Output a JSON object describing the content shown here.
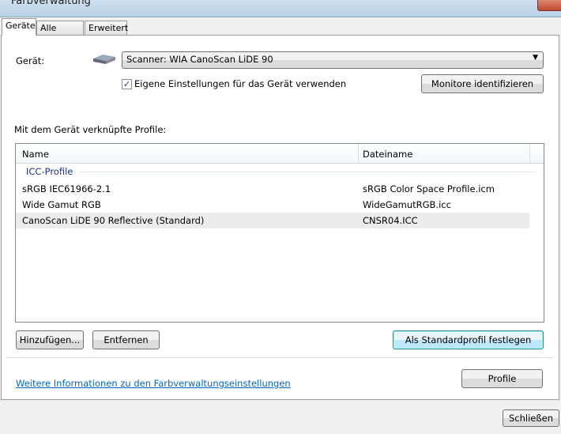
{
  "window": {
    "title": "Farbverwaltung"
  },
  "tabs": [
    {
      "label": "Geräte"
    },
    {
      "label": "Alle Profile"
    },
    {
      "label": "Erweitert"
    }
  ],
  "device": {
    "label": "Gerät:",
    "selected": "Scanner: WIA CanoScan LiDE 90",
    "use_own_settings_label": "Eigene Einstellungen für das Gerät verwenden",
    "use_own_settings_checked": true,
    "identify_button": "Monitore identifizieren"
  },
  "profiles": {
    "label": "Mit dem Gerät verknüpfte Profile:",
    "columns": [
      "Name",
      "Dateiname"
    ],
    "group": "ICC-Profile",
    "rows": [
      {
        "name": "sRGB IEC61966-2.1",
        "file": "sRGB Color Space Profile.icm"
      },
      {
        "name": "Wide Gamut RGB",
        "file": "WideGamutRGB.icc"
      },
      {
        "name": "CanoScan LiDE 90 Reflective (Standard)",
        "file": "CNSR04.ICC",
        "selected": true
      }
    ]
  },
  "buttons": {
    "add": "Hinzufügen...",
    "remove": "Entfernen",
    "set_default": "Als Standardprofil festlegen",
    "profile": "Profile",
    "close": "Schließen"
  },
  "link": "Weitere Informationen zu den Farbverwaltungseinstellungen",
  "colors": {
    "link": "#0066cc",
    "group": "#1e3287"
  }
}
